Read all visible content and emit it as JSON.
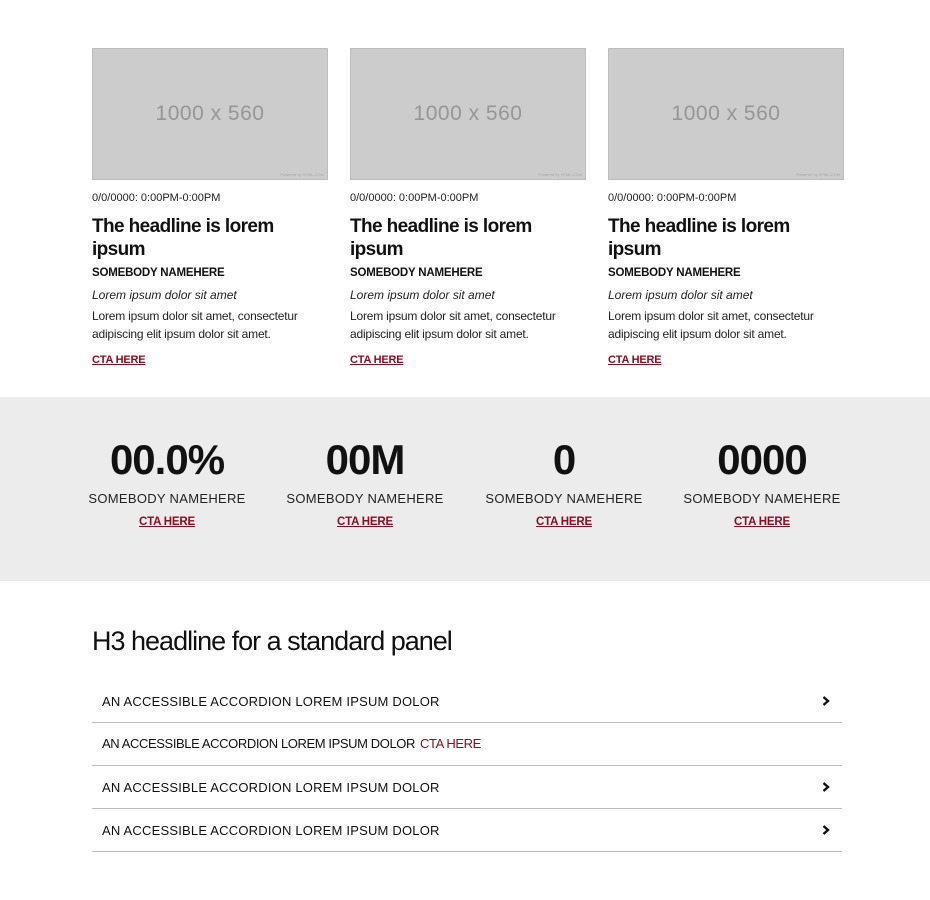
{
  "cards": [
    {
      "image_placeholder": "1000 x 560",
      "image_credit": "Powered by HTML.COM",
      "date": "0/0/0000: 0:00PM-0:00PM",
      "headline": "The headline is lorem ipsum",
      "author": "SOMEBODY NAMEHERE",
      "subtitle": "Lorem ipsum dolor sit amet",
      "body": "Lorem ipsum dolor sit amet, consectetur adipiscing elit ipsum dolor sit amet.",
      "cta": "CTA HERE"
    },
    {
      "image_placeholder": "1000 x 560",
      "image_credit": "Powered by HTML.COM",
      "date": "0/0/0000: 0:00PM-0:00PM",
      "headline": "The headline is lorem ipsum",
      "author": "SOMEBODY NAMEHERE",
      "subtitle": "Lorem ipsum dolor sit amet",
      "body": "Lorem ipsum dolor sit amet, consectetur adipiscing elit ipsum dolor sit amet.",
      "cta": "CTA HERE"
    },
    {
      "image_placeholder": "1000 x 560",
      "image_credit": "Powered by HTML.COM",
      "date": "0/0/0000: 0:00PM-0:00PM",
      "headline": "The headline is lorem ipsum",
      "author": "SOMEBODY NAMEHERE",
      "subtitle": "Lorem ipsum dolor sit amet",
      "body": "Lorem ipsum dolor sit amet, consectetur adipiscing elit ipsum dolor sit amet.",
      "cta": "CTA HERE"
    }
  ],
  "stats": [
    {
      "value": "00.0%",
      "label": "SOMEBODY NAMEHERE",
      "cta": "CTA HERE"
    },
    {
      "value": "00M",
      "label": "SOMEBODY NAMEHERE",
      "cta": "CTA HERE"
    },
    {
      "value": "0",
      "label": "SOMEBODY NAMEHERE",
      "cta": "CTA HERE"
    },
    {
      "value": "0000",
      "label": "SOMEBODY NAMEHERE",
      "cta": "CTA HERE"
    }
  ],
  "panel": {
    "title": "H3 headline for a standard panel",
    "accordion": [
      {
        "label": "AN ACCESSIBLE ACCORDION LOREM IPSUM DOLOR",
        "icon": "chevron-right-icon"
      },
      {
        "label": "AN ACCESSIBLE ACCORDION LOREM IPSUM DOLOR",
        "cta": "CTA HERE"
      },
      {
        "label": "AN ACCESSIBLE ACCORDION LOREM IPSUM DOLOR",
        "icon": "chevron-right-icon"
      },
      {
        "label": "AN ACCESSIBLE ACCORDION LOREM IPSUM DOLOR",
        "icon": "chevron-right-icon"
      }
    ]
  },
  "colors": {
    "accent": "#8b0e24",
    "band_background": "#ececec",
    "image_placeholder": "#cccccc",
    "divider": "#bcbcbc"
  }
}
